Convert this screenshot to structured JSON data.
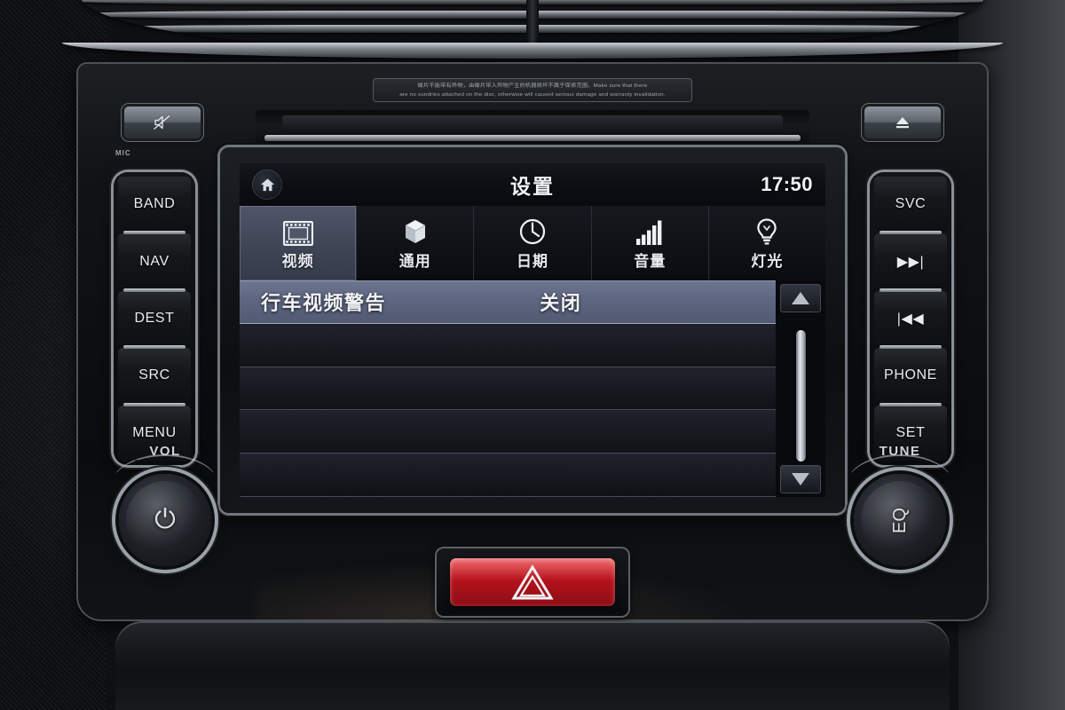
{
  "device": {
    "name": "car-infotainment-head-unit",
    "disc_warning_line1": "碟片不能带有异物，由碟片带入异物产生的机器损坏不属于保修范围。Make sure that there",
    "disc_warning_line2": "are no sundries attached on the disc, otherwise will caused serious damage and warranty invalidation.",
    "mic_label": "MIC"
  },
  "screen": {
    "title": "设置",
    "clock": "17:50",
    "home_icon": "home-icon",
    "tabs": [
      {
        "label": "视频",
        "icon": "film-strip-icon",
        "active": true
      },
      {
        "label": "通用",
        "icon": "cube-icon",
        "active": false
      },
      {
        "label": "日期",
        "icon": "clock-icon",
        "active": false
      },
      {
        "label": "音量",
        "icon": "signal-bars-icon",
        "active": false
      },
      {
        "label": "灯光",
        "icon": "lightbulb-icon",
        "active": false
      }
    ],
    "rows": [
      {
        "label": "行车视频警告",
        "value": "关闭",
        "selected": true
      },
      {
        "label": "",
        "value": "",
        "selected": false
      },
      {
        "label": "",
        "value": "",
        "selected": false
      },
      {
        "label": "",
        "value": "",
        "selected": false
      },
      {
        "label": "",
        "value": "",
        "selected": false
      }
    ],
    "scrollbar": {
      "up": "scroll-up-arrow",
      "down": "scroll-down-arrow"
    }
  },
  "hardware": {
    "top_buttons": [
      {
        "name": "mute-button",
        "icon": "speaker-mute-icon"
      },
      {
        "name": "eject-button",
        "icon": "eject-icon"
      }
    ],
    "left_buttons": [
      "BAND",
      "NAV",
      "DEST",
      "SRC",
      "MENU"
    ],
    "right_buttons": [
      "SVC",
      "▶▶|",
      "|◀◀",
      "PHONE",
      "SET"
    ],
    "knobs": [
      {
        "label": "VOL",
        "glyph": "⏻",
        "name": "volume-power-knob"
      },
      {
        "label": "TUNE",
        "glyph": "EQ",
        "name": "tune-eq-knob"
      }
    ],
    "hazard_button": {
      "name": "hazard-lights-button",
      "icon": "warning-triangle-icon"
    }
  },
  "colors": {
    "accent_row": "#5e6680",
    "screen_bg": "#0b0d12",
    "hazard_red": "#b5121a",
    "text_light": "#f2f4f8"
  }
}
